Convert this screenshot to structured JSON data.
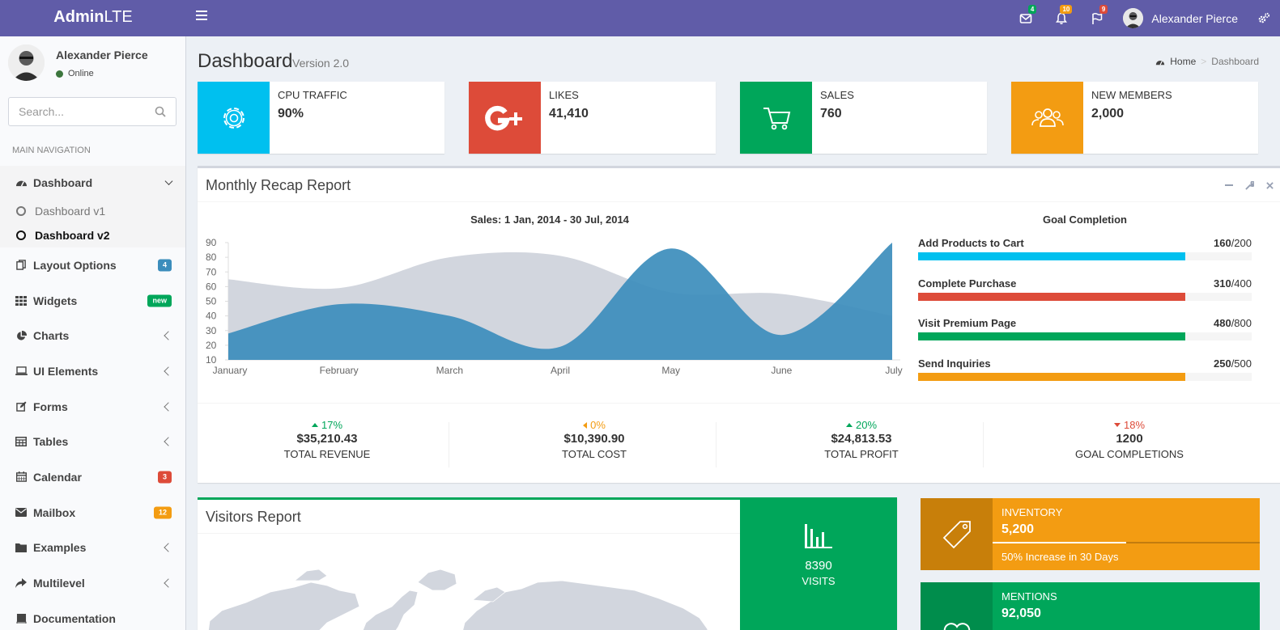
{
  "header": {
    "logo_bold": "Admin",
    "logo_light": "LTE",
    "badges": {
      "messages": "4",
      "notifications": "10",
      "tasks": "9"
    },
    "user_name": "Alexander Pierce"
  },
  "sidebar": {
    "user_name": "Alexander Pierce",
    "user_status": "Online",
    "search_placeholder": "Search...",
    "nav_header": "MAIN NAVIGATION",
    "items": [
      {
        "label": "Dashboard"
      },
      {
        "label": "Dashboard v1"
      },
      {
        "label": "Dashboard v2"
      },
      {
        "label": "Layout Options",
        "badge": "4"
      },
      {
        "label": "Widgets",
        "badge": "new"
      },
      {
        "label": "Charts"
      },
      {
        "label": "UI Elements"
      },
      {
        "label": "Forms"
      },
      {
        "label": "Tables"
      },
      {
        "label": "Calendar",
        "badge": "3"
      },
      {
        "label": "Mailbox",
        "badge": "12"
      },
      {
        "label": "Examples"
      },
      {
        "label": "Multilevel"
      },
      {
        "label": "Documentation"
      }
    ]
  },
  "page": {
    "title": "Dashboard",
    "subtitle": "Version 2.0",
    "breadcrumb": [
      "Home",
      "Dashboard"
    ]
  },
  "info_boxes": [
    {
      "label": "CPU TRAFFIC",
      "value": "90%",
      "color": "#00c0ef",
      "icon": "gear-icon"
    },
    {
      "label": "LIKES",
      "value": "41,410",
      "color": "#dd4b39",
      "icon": "google-plus-icon"
    },
    {
      "label": "SALES",
      "value": "760",
      "color": "#00a65a",
      "icon": "cart-icon"
    },
    {
      "label": "NEW MEMBERS",
      "value": "2,000",
      "color": "#f39c12",
      "icon": "users-icon"
    }
  ],
  "recap": {
    "title": "Monthly Recap Report",
    "chart_title": "Sales: 1 Jan, 2014 - 30 Jul, 2014",
    "goal_title": "Goal Completion",
    "goals": [
      {
        "label": "Add Products to Cart",
        "done": "160",
        "total": "/200",
        "fraction": 0.8,
        "color": "#00c0ef"
      },
      {
        "label": "Complete Purchase",
        "done": "310",
        "total": "/400",
        "fraction": 0.8,
        "color": "#dd4b39"
      },
      {
        "label": "Visit Premium Page",
        "done": "480",
        "total": "/800",
        "fraction": 0.8,
        "color": "#00a65a"
      },
      {
        "label": "Send Inquiries",
        "done": "250",
        "total": "/500",
        "fraction": 0.8,
        "color": "#f39c12"
      }
    ],
    "stats": [
      {
        "pct": "17%",
        "dir": "up",
        "color": "#00a65a",
        "value": "$35,210.43",
        "label": "TOTAL REVENUE"
      },
      {
        "pct": "0%",
        "dir": "left",
        "color": "#f39c12",
        "value": "$10,390.90",
        "label": "TOTAL COST"
      },
      {
        "pct": "20%",
        "dir": "up",
        "color": "#00a65a",
        "value": "$24,813.53",
        "label": "TOTAL PROFIT"
      },
      {
        "pct": "18%",
        "dir": "down",
        "color": "#dd4b39",
        "value": "1200",
        "label": "GOAL COMPLETIONS"
      }
    ]
  },
  "chart_data": {
    "type": "area",
    "title": "Sales: 1 Jan, 2014 - 30 Jul, 2014",
    "x": [
      "January",
      "February",
      "March",
      "April",
      "May",
      "June",
      "July"
    ],
    "yticks": [
      10,
      20,
      30,
      40,
      50,
      60,
      70,
      80,
      90
    ],
    "ylim": [
      10,
      90
    ],
    "series": [
      {
        "values": [
          65,
          59,
          80,
          81,
          56,
          55,
          40
        ],
        "color": "#d2d6de"
      },
      {
        "values": [
          28,
          48,
          40,
          19,
          86,
          27,
          90
        ],
        "color": "#3c8dbc"
      }
    ]
  },
  "visitors": {
    "title": "Visitors Report",
    "visits_value": "8390",
    "visits_label": "VISITS"
  },
  "tiles": [
    {
      "label": "INVENTORY",
      "value": "5,200",
      "desc": "50% Increase in 30 Days",
      "progress": 0.5,
      "color": "#f39c12",
      "dark": "#c87f0a"
    },
    {
      "label": "MENTIONS",
      "value": "92,050",
      "color": "#00a65a",
      "dark": "#008d4c"
    }
  ]
}
